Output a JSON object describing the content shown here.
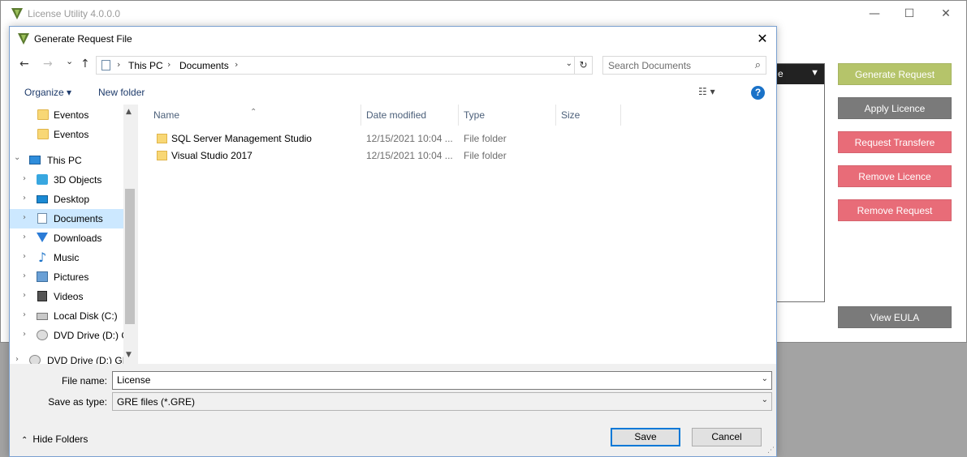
{
  "main_window": {
    "title": "License Utility 4.0.0.0",
    "controls": {
      "minimize": "—",
      "maximize": "☐",
      "close": "✕"
    },
    "table_header_partial": "e",
    "filter_icon": "funnel-icon",
    "buttons": [
      {
        "label": "Generate Request",
        "color": "#b5c46a"
      },
      {
        "label": "Apply Licence",
        "color": "#7a7a7a"
      },
      {
        "label": "Request Transfere",
        "color": "#e86c78"
      },
      {
        "label": "Remove Licence",
        "color": "#e86c78"
      },
      {
        "label": "Remove Request",
        "color": "#e86c78"
      }
    ],
    "view_eula": {
      "label": "View EULA",
      "color": "#7a7a7a"
    }
  },
  "dialog": {
    "title": "Generate Request File",
    "close": "✕",
    "nav": {
      "back": "←",
      "forward": "→",
      "recent": "⌄",
      "up": "↑"
    },
    "address": {
      "crumbs": [
        "This PC",
        "Documents"
      ],
      "separator": "›",
      "refresh": "↻"
    },
    "search": {
      "placeholder": "Search Documents"
    },
    "toolbar": {
      "organize": "Organize ▾",
      "new_folder": "New folder",
      "view": "☷ ▾",
      "help": "?"
    },
    "tree": [
      {
        "label": "Eventos",
        "icon": "folder-icon",
        "chev": ""
      },
      {
        "label": "Eventos",
        "icon": "folder-icon",
        "chev": ""
      },
      {
        "label": "This PC",
        "icon": "pc-icon",
        "chev": "⌄"
      },
      {
        "label": "3D Objects",
        "icon": "3d-objects-icon",
        "chev": "›"
      },
      {
        "label": "Desktop",
        "icon": "desktop-icon",
        "chev": "›"
      },
      {
        "label": "Documents",
        "icon": "documents-icon",
        "chev": "›",
        "selected": true
      },
      {
        "label": "Downloads",
        "icon": "downloads-icon",
        "chev": "›"
      },
      {
        "label": "Music",
        "icon": "music-icon",
        "chev": "›"
      },
      {
        "label": "Pictures",
        "icon": "pictures-icon",
        "chev": "›"
      },
      {
        "label": "Videos",
        "icon": "videos-icon",
        "chev": "›"
      },
      {
        "label": "Local Disk (C:)",
        "icon": "local-disk-icon",
        "chev": "›"
      },
      {
        "label": "DVD Drive (D:) G",
        "icon": "dvd-drive-icon",
        "chev": "›"
      },
      {
        "label": "DVD Drive (D:) GIS",
        "icon": "dvd-drive-icon",
        "chev": "›"
      }
    ],
    "columns": {
      "name": "Name",
      "date": "Date modified",
      "type": "Type",
      "size": "Size"
    },
    "files": [
      {
        "name": "SQL Server Management Studio",
        "date": "12/15/2021 10:04 ...",
        "type": "File folder"
      },
      {
        "name": "Visual Studio 2017",
        "date": "12/15/2021 10:04 ...",
        "type": "File folder"
      }
    ],
    "file_name": {
      "label": "File name:",
      "value": "License"
    },
    "save_as_type": {
      "label": "Save as type:",
      "value": "GRE files (*.GRE)"
    },
    "hide_folders": "Hide Folders",
    "save": "Save",
    "cancel": "Cancel"
  }
}
